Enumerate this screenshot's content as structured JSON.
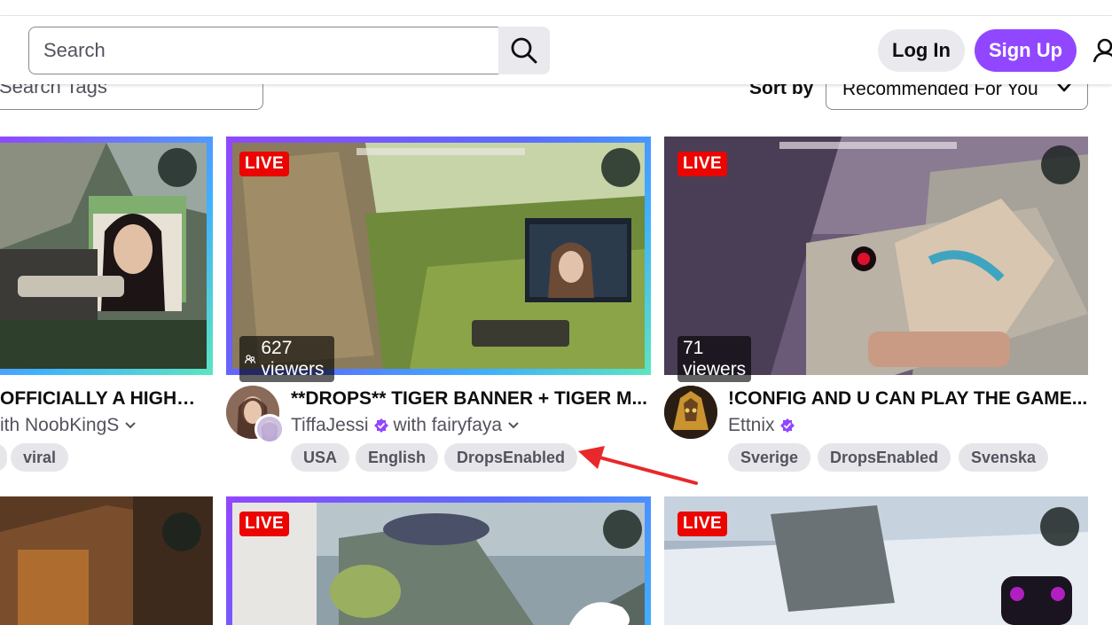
{
  "header": {
    "search_placeholder": "Search",
    "login_label": "Log In",
    "signup_label": "Sign Up"
  },
  "filters": {
    "tags_placeholder": "Search Tags",
    "sortby_label": "Sort by",
    "sort_selected": "Recommended For You"
  },
  "colors": {
    "brand": "#9147ff",
    "live": "#eb0400",
    "tag_bg": "#e6e6ea"
  },
  "cards": [
    {
      "title": "OFFICIALLY A HIGHG...",
      "channel_prefix": "ith NoobKingS",
      "tags": [
        "",
        "viral"
      ]
    },
    {
      "live": "LIVE",
      "viewers": "627 viewers",
      "title": "**DROPS** TIGER BANNER + TIGER M...",
      "channel": "TiffaJessi",
      "with_text": "with fairyfaya",
      "tags": [
        "USA",
        "English",
        "DropsEnabled"
      ]
    },
    {
      "live": "LIVE",
      "viewers": "71 viewers",
      "title": "!CONFIG AND U CAN PLAY THE GAME...",
      "channel": "Ettnix",
      "tags": [
        "Sverige",
        "DropsEnabled",
        "Svenska"
      ]
    },
    {},
    {
      "live": "LIVE"
    },
    {
      "live": "LIVE"
    }
  ]
}
